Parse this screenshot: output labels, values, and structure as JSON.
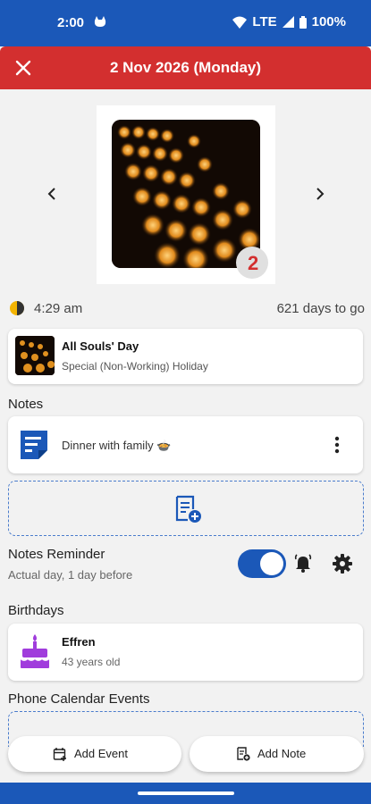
{
  "status_bar": {
    "time": "2:00",
    "network": "LTE",
    "battery": "100%"
  },
  "header": {
    "title": "2 Nov 2026 (Monday)"
  },
  "photo": {
    "badge": "2"
  },
  "moon": {
    "time": "4:29 am",
    "countdown": "621 days to go"
  },
  "holiday": {
    "name": "All Souls' Day",
    "type": "Special (Non-Working) Holiday"
  },
  "notes": {
    "label": "Notes",
    "items": [
      {
        "text": "Dinner with family 🍲"
      }
    ]
  },
  "reminder": {
    "title": "Notes Reminder",
    "subtitle": "Actual day, 1 day before",
    "enabled": true
  },
  "birthdays": {
    "label": "Birthdays",
    "items": [
      {
        "name": "Effren",
        "age": "43 years old"
      }
    ]
  },
  "phone_calendar": {
    "label": "Phone Calendar Events"
  },
  "actions": {
    "add_event": "Add Event",
    "add_note": "Add Note"
  },
  "colors": {
    "primary": "#1b58b8",
    "header": "#d32f2f",
    "accent_purple": "#a03cdc"
  }
}
